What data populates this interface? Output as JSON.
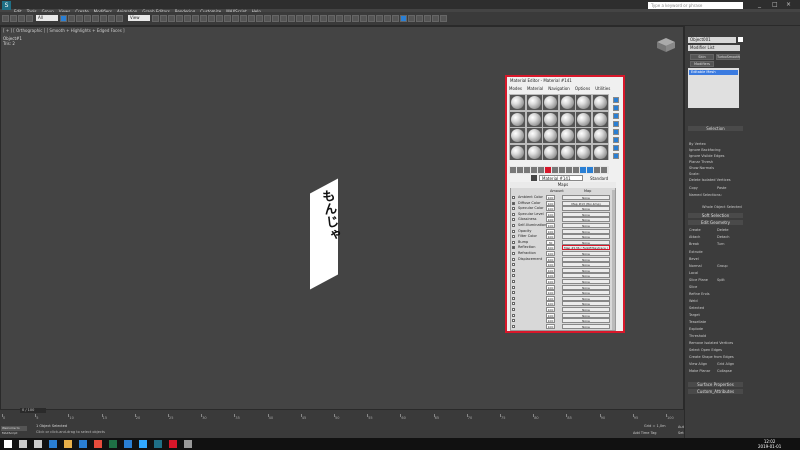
{
  "app": {
    "logo": "S"
  },
  "menu": [
    "Edit",
    "Tools",
    "Group",
    "Views",
    "Create",
    "Modifiers",
    "Animation",
    "Graph Editors",
    "Rendering",
    "Customize",
    "MAXScript",
    "Help"
  ],
  "toolbar": {
    "undo_icon": "undo-icon",
    "redo_icon": "redo-icon",
    "selection_set": "All",
    "view_mode": "View",
    "search_placeholder": "Type a keyword or phrase",
    "window_controls": [
      "_",
      "□",
      "×"
    ]
  },
  "viewport": {
    "label": "[ + ] [ Orthographic ] [ Smooth + Highlights + Edged Faces ]",
    "stats_label": "Object#1",
    "stats_tris": "Tris:    2",
    "plane_text": "もんじゃ"
  },
  "timeline": {
    "frame_counter": "0 / 100",
    "ticks": [
      "0",
      "5",
      "10",
      "15",
      "20",
      "25",
      "30",
      "35",
      "40",
      "45",
      "50",
      "55",
      "60",
      "65",
      "70",
      "75",
      "80",
      "85",
      "90",
      "95",
      "100"
    ]
  },
  "status": {
    "selected": "1 Object Selected",
    "prompt": "Click or click-and-drag to select objects",
    "welcome": "Welcome to MAXScript",
    "grid": "Grid = 1,0m",
    "add_time_tag": "Add Time Tag",
    "auto_key": "Auto Key",
    "set_key": "Set Key",
    "selected_dropdown": "Selected",
    "key_filters": "Key Filters..."
  },
  "command_panel": {
    "object_name": "Object001",
    "modifier_list": "Modifier List",
    "btn_skin": "Skin",
    "btn_turbosmooth": "TurboSmooth",
    "btn_modifiers": "Modifiers",
    "stack_selected": "Editable Mesh",
    "sections": {
      "selection": "Selection",
      "soft_selection": "Soft Selection",
      "edit_geometry": "Edit Geometry",
      "surface_properties": "Surface Properties",
      "custom_attributes": "Custom_Attributes"
    },
    "rows": {
      "by_vertex": "By Vertex",
      "ignore_backfacing": "Ignore Backfacing",
      "ignore_visible": "Ignore Visible Edges",
      "planar_thresh": "Planar Thresh",
      "show_normals": "Show Normals",
      "scale": "Scale:",
      "delete_isolated": "Delete Isolated Vertices",
      "whole_object": "Whole Object Selected",
      "named_selections": "Named Selections:",
      "copy": "Copy",
      "paste": "Paste",
      "create": "Create",
      "delete": "Delete",
      "attach": "Attach",
      "detach": "Detach",
      "break": "Break",
      "turn": "Turn",
      "extrude": "Extrude",
      "bevel": "Bevel",
      "normal": "Normal",
      "group": "Group",
      "local": "Local",
      "slice_plane": "Slice Plane",
      "split": "Split",
      "slice": "Slice",
      "refine_ends": "Refine Ends",
      "weld": "Weld",
      "selected": "Selected",
      "target": "Target",
      "tessellate": "Tessellate",
      "explode": "Explode",
      "remove_isolated": "Remove Isolated Vertices",
      "select_open_edges": "Select Open Edges",
      "create_shape": "Create Shape from Edges",
      "view_align": "View Align",
      "grid_align": "Grid Align",
      "make_planar": "Make Planar",
      "collapse": "Collapse",
      "threshold": "Threshold"
    }
  },
  "material_editor": {
    "title": "Material Editor - Material #141",
    "menu": [
      "Modes",
      "Material",
      "Navigation",
      "Options",
      "Utilities"
    ],
    "material_name": "Material #141",
    "material_type": "Standard",
    "maps_title": "Maps",
    "col_amount": "Amount",
    "col_map": "Map",
    "rows": [
      {
        "label": "Ambient Color",
        "amount": "100",
        "map": "None",
        "checked": false
      },
      {
        "label": "Diffuse Color",
        "amount": "100",
        "map": "Map #13 (fbx.bmp)",
        "checked": true
      },
      {
        "label": "Specular Color",
        "amount": "100",
        "map": "None",
        "checked": false
      },
      {
        "label": "Specular Level",
        "amount": "100",
        "map": "None",
        "checked": false
      },
      {
        "label": "Glossiness",
        "amount": "100",
        "map": "None",
        "checked": false
      },
      {
        "label": "Self-Illumination",
        "amount": "100",
        "map": "None",
        "checked": false
      },
      {
        "label": "Opacity",
        "amount": "100",
        "map": "None",
        "checked": false
      },
      {
        "label": "Filter Color",
        "amount": "100",
        "map": "None",
        "checked": false
      },
      {
        "label": "Bump",
        "amount": "30",
        "map": "None",
        "checked": false
      },
      {
        "label": "Reflection",
        "amount": "100",
        "map": "Map #136 ( Falloff/Raytrace )",
        "checked": true
      },
      {
        "label": "Refraction",
        "amount": "100",
        "map": "None",
        "checked": false
      },
      {
        "label": "Displacement",
        "amount": "100",
        "map": "None",
        "checked": false
      },
      {
        "label": "",
        "amount": "100",
        "map": "None",
        "checked": false
      },
      {
        "label": "",
        "amount": "100",
        "map": "None",
        "checked": false
      },
      {
        "label": "",
        "amount": "100",
        "map": "None",
        "checked": false
      },
      {
        "label": "",
        "amount": "100",
        "map": "None",
        "checked": false
      },
      {
        "label": "",
        "amount": "100",
        "map": "None",
        "checked": false
      },
      {
        "label": "",
        "amount": "100",
        "map": "None",
        "checked": false
      },
      {
        "label": "",
        "amount": "100",
        "map": "None",
        "checked": false
      },
      {
        "label": "",
        "amount": "100",
        "map": "None",
        "checked": false
      },
      {
        "label": "",
        "amount": "100",
        "map": "None",
        "checked": false
      },
      {
        "label": "",
        "amount": "100",
        "map": "None",
        "checked": false
      },
      {
        "label": "",
        "amount": "100",
        "map": "None",
        "checked": false
      },
      {
        "label": "",
        "amount": "100",
        "map": "None",
        "checked": false
      }
    ],
    "highlight_color": "#d8172a"
  },
  "clock": {
    "time": "12:02",
    "date": "2019-01-01"
  }
}
